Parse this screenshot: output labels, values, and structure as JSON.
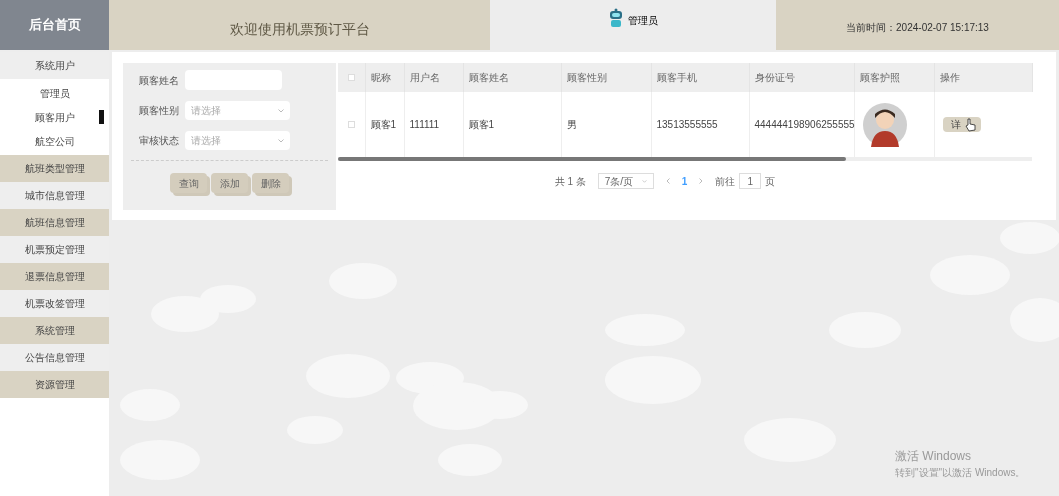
{
  "header": {
    "home": "后台首页",
    "title": "欢迎使用机票预订平台",
    "user": "管理员",
    "time": "当前时间：2024-02-07 15:17:13"
  },
  "sidebar": {
    "items": [
      {
        "label": "系统用户",
        "shaded": false,
        "expanded": true,
        "children": [
          {
            "label": "管理员",
            "selected": false
          },
          {
            "label": "顾客用户",
            "selected": true
          },
          {
            "label": "航空公司",
            "selected": false
          }
        ]
      },
      {
        "label": "航班类型管理",
        "shaded": true
      },
      {
        "label": "城市信息管理",
        "shaded": false
      },
      {
        "label": "航班信息管理",
        "shaded": true
      },
      {
        "label": "机票预定管理",
        "shaded": false
      },
      {
        "label": "退票信息管理",
        "shaded": true
      },
      {
        "label": "机票改签管理",
        "shaded": false
      },
      {
        "label": "系统管理",
        "shaded": true
      },
      {
        "label": "公告信息管理",
        "shaded": false
      },
      {
        "label": "资源管理",
        "shaded": true
      }
    ]
  },
  "filters": [
    {
      "kind": "input",
      "label": "顾客姓名"
    },
    {
      "kind": "select",
      "label": "顾客性别",
      "placeholder": "请选择"
    },
    {
      "kind": "select",
      "label": "审核状态",
      "placeholder": "请选择"
    }
  ],
  "buttons": [
    "查询",
    "添加",
    "删除"
  ],
  "table": {
    "columns": [
      "昵称",
      "用户名",
      "顾客姓名",
      "顾客性别",
      "顾客手机",
      "身份证号",
      "顾客护照",
      "操作"
    ],
    "all_checked": false,
    "rows": [
      {
        "checked": false,
        "cells": [
          "顾客1",
          "111111",
          "顾客1",
          "男",
          "13513555555",
          "444444198906255555"
        ],
        "action": "详"
      }
    ]
  },
  "pagination": {
    "total": "共 1 条",
    "page_size": "7条/页",
    "pages": [
      {
        "label": "1",
        "selected": true
      }
    ],
    "goto_label": "前往",
    "goto_value": "1",
    "goto_suffix": "页"
  },
  "activation": {
    "title": "激活 Windows",
    "hint": "转到\"设置\"以激活 Windows。"
  }
}
